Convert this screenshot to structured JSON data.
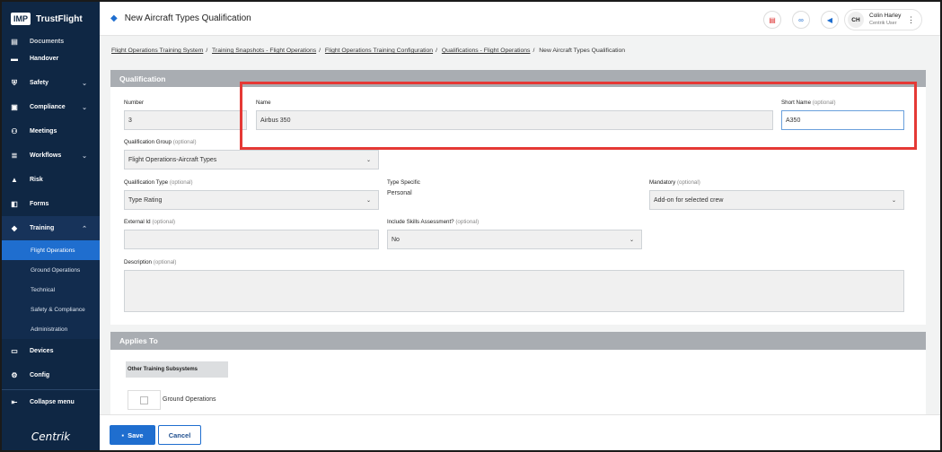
{
  "brand": {
    "logo": "IMP",
    "name": "TrustFlight",
    "footer_logo": "Centrik"
  },
  "sidebar": {
    "partial_item": "Documents",
    "items": [
      {
        "label": "Handover",
        "icon": "handover-icon"
      },
      {
        "label": "Safety",
        "icon": "shield-icon",
        "chevron": "⌄"
      },
      {
        "label": "Compliance",
        "icon": "compliance-icon",
        "chevron": "⌄"
      },
      {
        "label": "Meetings",
        "icon": "meetings-icon"
      },
      {
        "label": "Workflows",
        "icon": "workflows-icon",
        "chevron": "⌄"
      },
      {
        "label": "Risk",
        "icon": "risk-icon"
      },
      {
        "label": "Forms",
        "icon": "forms-icon"
      },
      {
        "label": "Training",
        "icon": "graduation-cap-icon",
        "chevron": "⌃"
      }
    ],
    "training_sub": [
      "Flight Operations",
      "Ground Operations",
      "Technical",
      "Safety & Compliance",
      "Administration"
    ],
    "items_after": [
      {
        "label": "Devices",
        "icon": "devices-icon"
      },
      {
        "label": "Config",
        "icon": "config-icon"
      }
    ],
    "collapse_label": "Collapse menu"
  },
  "header": {
    "title": "New Aircraft Types Qualification",
    "user_initials": "CH",
    "user_name": "Colin Harley",
    "user_role": "Centrik User"
  },
  "breadcrumbs": [
    "Flight Operations Training System",
    "Training Snapshots - Flight Operations",
    "Flight Operations Training Configuration",
    "Qualifications - Flight Operations"
  ],
  "breadcrumb_current": "New Aircraft Types Qualification",
  "qualification": {
    "section_title": "Qualification",
    "number_label": "Number",
    "number_value": "3",
    "name_label": "Name",
    "name_value": "Airbus 350",
    "short_name_label": "Short Name",
    "short_name_value": "A350",
    "optional": "(optional)",
    "group_label": "Qualification Group",
    "group_value": "Flight Operations-Aircraft Types",
    "type_label": "Qualification Type",
    "type_value": "Type Rating",
    "type_specific_label": "Type Specific",
    "type_specific_value": "Personal",
    "mandatory_label": "Mandatory",
    "mandatory_value": "Add-on for selected crew",
    "external_id_label": "External Id",
    "external_id_value": "",
    "skills_label": "Include Skills Assessment?",
    "skills_value": "No",
    "description_label": "Description",
    "description_value": ""
  },
  "applies_to": {
    "section_title": "Applies To",
    "column_header": "Other Training Subsystems",
    "rows": [
      "Ground Operations"
    ]
  },
  "footer": {
    "save_label": "Save",
    "cancel_label": "Cancel"
  },
  "colors": {
    "sidebar": "#0f2744",
    "accent": "#1f6ecf",
    "highlight_box": "#e53935",
    "section_header": "#a9adb2"
  }
}
